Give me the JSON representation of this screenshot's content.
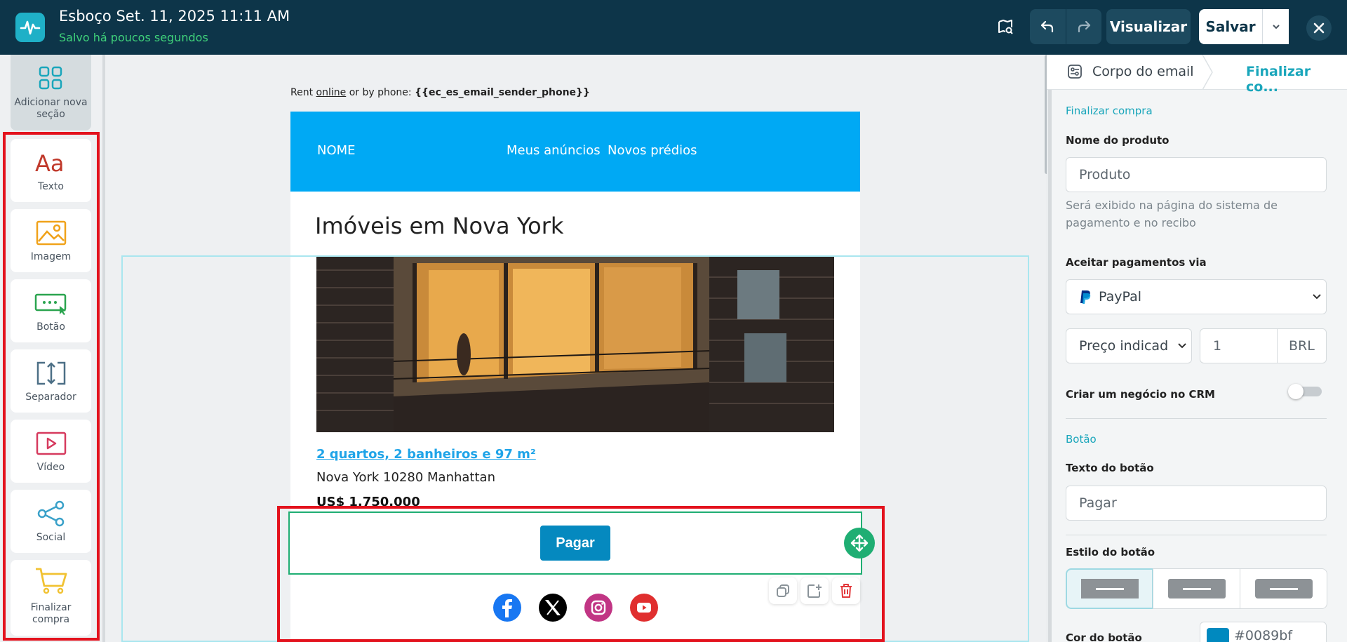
{
  "header": {
    "title": "Esboço Set. 11, 2025 11:11 AM",
    "status": "Salvo há poucos segundos",
    "preview_label": "Visualizar",
    "save_label": "Salvar"
  },
  "sidebar": {
    "add_section_label": "Adicionar nova seção",
    "blocks": [
      {
        "label": "Texto",
        "icon": "text-icon"
      },
      {
        "label": "Imagem",
        "icon": "image-icon"
      },
      {
        "label": "Botão",
        "icon": "button-icon"
      },
      {
        "label": "Separador",
        "icon": "separator-icon"
      },
      {
        "label": "Vídeo",
        "icon": "video-icon"
      },
      {
        "label": "Social",
        "icon": "share-icon"
      },
      {
        "label": "Finalizar compra",
        "icon": "cart-icon"
      }
    ]
  },
  "email": {
    "rent_prefix": "Rent ",
    "rent_link": "online",
    "rent_mid": " or by phone: ",
    "rent_var": "{{ec_es_email_sender_phone}}",
    "nav": [
      "NOME",
      "Meus anúncios",
      "Novos prédios"
    ],
    "heading": "Imóveis em Nova York",
    "property_link": "2 quartos, 2 banheiros e 97 m²",
    "address": "Nova York 10280 Manhattan",
    "price": "US$ 1.750.000",
    "pay_button": "Pagar",
    "social": [
      "facebook-icon",
      "x-icon",
      "instagram-icon",
      "youtube-icon"
    ]
  },
  "panel": {
    "tab_body": "Corpo do email",
    "tab_checkout": "Finalizar co...",
    "section_checkout": "Finalizar compra",
    "product_name_label": "Nome do produto",
    "product_name_placeholder": "Produto",
    "product_hint": "Será exibido na página do sistema de pagamento e no recibo",
    "accept_label": "Aceitar pagamentos via",
    "payment_method": "PayPal",
    "price_type": "Preço indicad",
    "price_value": "1",
    "currency": "BRL",
    "crm_label": "Criar um negócio no CRM",
    "crm_enabled": false,
    "section_button": "Botão",
    "button_text_label": "Texto do botão",
    "button_text_value": "Pagar",
    "button_style_label": "Estilo do botão",
    "button_color_label": "Cor do botão",
    "button_color_value": "#0089bf"
  },
  "colors": {
    "header_bg": "#0d3549",
    "accent": "#1aa6bb",
    "nav_bg": "#00a9f4",
    "pay_button": "#0589bf",
    "highlight": "#e3121d",
    "selected_block": "#1fae73"
  }
}
